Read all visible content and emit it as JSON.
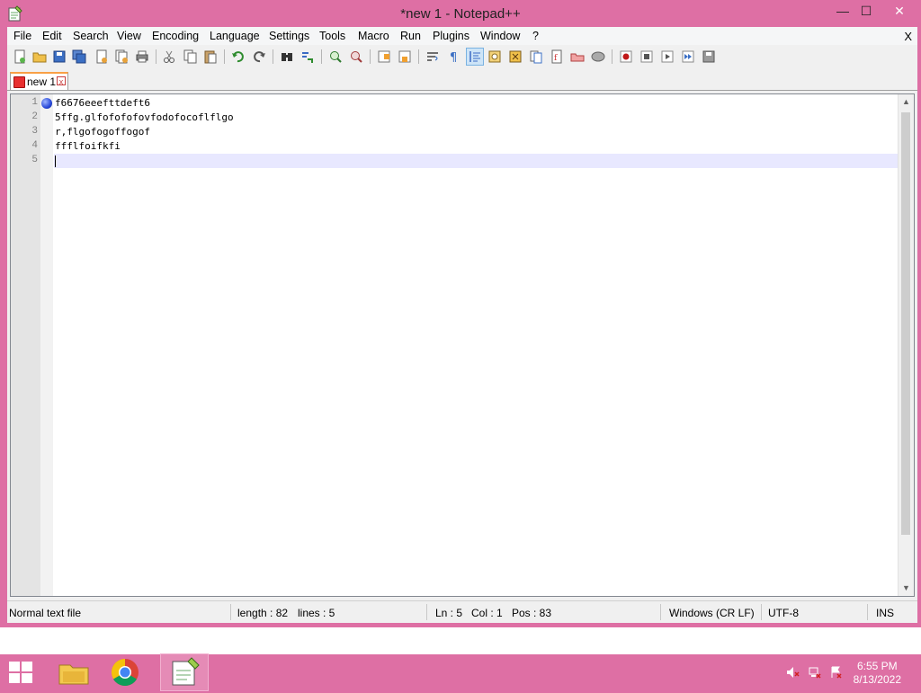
{
  "window": {
    "title": "*new 1 - Notepad++",
    "minimize_glyph": "—",
    "maximize_glyph": "☐",
    "close_glyph": "✕"
  },
  "menu": {
    "items": [
      "File",
      "Edit",
      "Search",
      "View",
      "Encoding",
      "Language",
      "Settings",
      "Tools",
      "Macro",
      "Run",
      "Plugins",
      "Window",
      "?"
    ],
    "close_doc": "X"
  },
  "tab": {
    "label": "new 1",
    "close_glyph": "x"
  },
  "editor": {
    "lines": [
      {
        "number": "1",
        "text": "f6676eeefttdeft6"
      },
      {
        "number": "2",
        "text": "5ffg.glfofofofovfodofocoflflgo"
      },
      {
        "number": "3",
        "text": "r,flgofogoffogof"
      },
      {
        "number": "4",
        "text": "ffflfoifkfi"
      },
      {
        "number": "5",
        "text": ""
      }
    ]
  },
  "status": {
    "file_type": "Normal text file",
    "length": "length : 82",
    "lines": "lines : 5",
    "ln": "Ln : 5",
    "col": "Col : 1",
    "pos": "Pos : 83",
    "eol": "Windows (CR LF)",
    "encoding": "UTF-8",
    "mode": "INS"
  },
  "taskbar": {
    "time": "6:55 PM",
    "date": "8/13/2022"
  },
  "colors": {
    "window_frame": "#de6fa4",
    "tab_accent": "#f9a046",
    "current_line": "#e8e8ff",
    "bookmark": "#2848d8"
  }
}
